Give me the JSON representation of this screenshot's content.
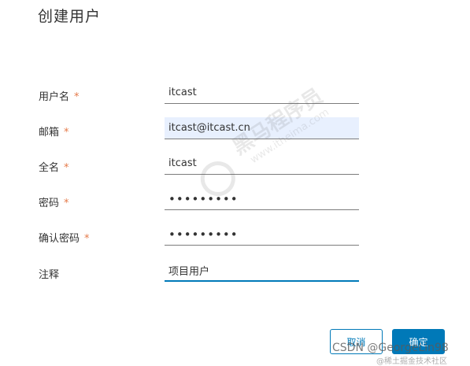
{
  "dialog": {
    "title": "创建用户"
  },
  "form": {
    "username": {
      "label": "用户名",
      "required_mark": "*",
      "value": "itcast"
    },
    "email": {
      "label": "邮箱",
      "required_mark": "*",
      "value": "itcast@itcast.cn"
    },
    "fullname": {
      "label": "全名",
      "required_mark": "*",
      "value": "itcast"
    },
    "password": {
      "label": "密码",
      "required_mark": "*",
      "value": "itcast123"
    },
    "confirm_password": {
      "label": "确认密码",
      "required_mark": "*",
      "value": "itcast123"
    },
    "note": {
      "label": "注释",
      "value": "项目用户"
    }
  },
  "buttons": {
    "cancel_label": "取消",
    "confirm_label": "确定"
  },
  "watermarks": {
    "logo_text": "黑马程序员",
    "logo_sub": "www.itheima.com",
    "csdn": "CSDN @GeorgeLin98",
    "community": "@稀土掘金技术社区"
  },
  "colors": {
    "primary": "#0079b8",
    "required": "#e57a4a",
    "autofill_bg": "#e8f0fe"
  }
}
